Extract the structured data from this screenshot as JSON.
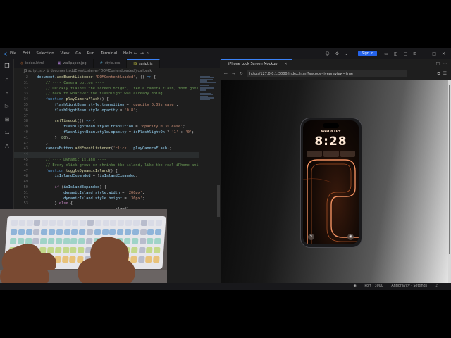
{
  "menu": [
    "File",
    "Edit",
    "Selection",
    "View",
    "Go",
    "Run",
    "Terminal",
    "Help"
  ],
  "signin_label": "Sign In",
  "tabs": [
    {
      "icon": "◇",
      "label": "index.html"
    },
    {
      "icon": "▣",
      "label": "wallpaper.jpg"
    },
    {
      "icon": "#",
      "label": "style.css"
    },
    {
      "icon": "JS",
      "label": "script.js"
    }
  ],
  "breadcrumb": "JS script.js > ⚙ document.addEventListener('DOMContentLoaded') callback",
  "code": [
    {
      "n": "2",
      "html": "<span class=\"v\">document</span>.<span class=\"f\">addEventListener</span>(<span class=\"s\">'DOMContentLoaded'</span>, () <span class=\"b\">=&gt;</span> {"
    },
    {
      "n": "31",
      "html": "    <span class=\"c\">// ---- Camera button ----</span>"
    },
    {
      "n": "32",
      "html": "    <span class=\"c\">// Quickly flashes the screen bright, like a camera flash, then goes</span>"
    },
    {
      "n": "33",
      "html": "    <span class=\"c\">// back to whatever the flashlight was already doing</span>"
    },
    {
      "n": "34",
      "html": "    <span class=\"b\">function</span> <span class=\"f\">playCameraFlash</span>() {"
    },
    {
      "n": "35",
      "html": "        <span class=\"v\">flashlightBeam</span>.<span class=\"v\">style</span>.<span class=\"v\">transition</span> = <span class=\"s\">'opacity 0.05s ease'</span>;"
    },
    {
      "n": "36",
      "html": "        <span class=\"v\">flashlightBeam</span>.<span class=\"v\">style</span>.<span class=\"v\">opacity</span> = <span class=\"s\">'0.8'</span>;"
    },
    {
      "n": "37",
      "html": ""
    },
    {
      "n": "38",
      "html": "        <span class=\"f\">setTimeout</span>(() <span class=\"b\">=&gt;</span> {"
    },
    {
      "n": "39",
      "html": "            <span class=\"v\">flashlightBeam</span>.<span class=\"v\">style</span>.<span class=\"v\">transition</span> = <span class=\"s\">'opacity 0.3s ease'</span>;"
    },
    {
      "n": "40",
      "html": "            <span class=\"v\">flashlightBeam</span>.<span class=\"v\">style</span>.<span class=\"v\">opacity</span> = <span class=\"v\">isFlashlightOn</span> ? <span class=\"s\">'1'</span> : <span class=\"s\">'0'</span>;"
    },
    {
      "n": "41",
      "html": "        }, <span class=\"n\">80</span>);"
    },
    {
      "n": "42",
      "html": "    }"
    },
    {
      "n": "43",
      "html": "    <span class=\"v\">cameraButton</span>.<span class=\"f\">addEventListener</span>(<span class=\"s\">'click'</span>, <span class=\"v\">playCameraFlash</span>);"
    },
    {
      "n": "44",
      "html": "",
      "current": true
    },
    {
      "n": "45",
      "html": "    <span class=\"c\">// ---- Dynamic Island ----</span>"
    },
    {
      "n": "46",
      "html": "    <span class=\"c\">// Every click grows or shrinks the island, like the real iPhone ani</span>"
    },
    {
      "n": "47",
      "html": "    <span class=\"b\">function</span> <span class=\"f\">toggleDynamicIsland</span>() {"
    },
    {
      "n": "48",
      "html": "        <span class=\"v\">isIslandExpanded</span> = !<span class=\"v\">isIslandExpanded</span>;"
    },
    {
      "n": "49",
      "html": ""
    },
    {
      "n": "50",
      "html": "        <span class=\"k\">if</span> (<span class=\"v\">isIslandExpanded</span>) {"
    },
    {
      "n": "51",
      "html": "            <span class=\"v\">dynamicIsland</span>.<span class=\"v\">style</span>.<span class=\"v\">width</span> = <span class=\"s\">'200px'</span>;"
    },
    {
      "n": "52",
      "html": "            <span class=\"v\">dynamicIsland</span>.<span class=\"v\">style</span>.<span class=\"v\">height</span> = <span class=\"s\">'36px'</span>;"
    },
    {
      "n": "53",
      "html": "        } <span class=\"k\">else</span> {"
    },
    {
      "n": "",
      "html": "                                   <span class=\"p\">sland);</span>"
    }
  ],
  "browser": {
    "tab_title": "iPhone Lock Screen Mockup",
    "url": "http://127.0.0.1:3000/index.html?vscode-livepreview=true"
  },
  "phone": {
    "date": "Wed 8 Oct",
    "time": "8:28"
  },
  "status": {
    "port": "Port : 3000",
    "settings": "Antigravity - Settings"
  }
}
